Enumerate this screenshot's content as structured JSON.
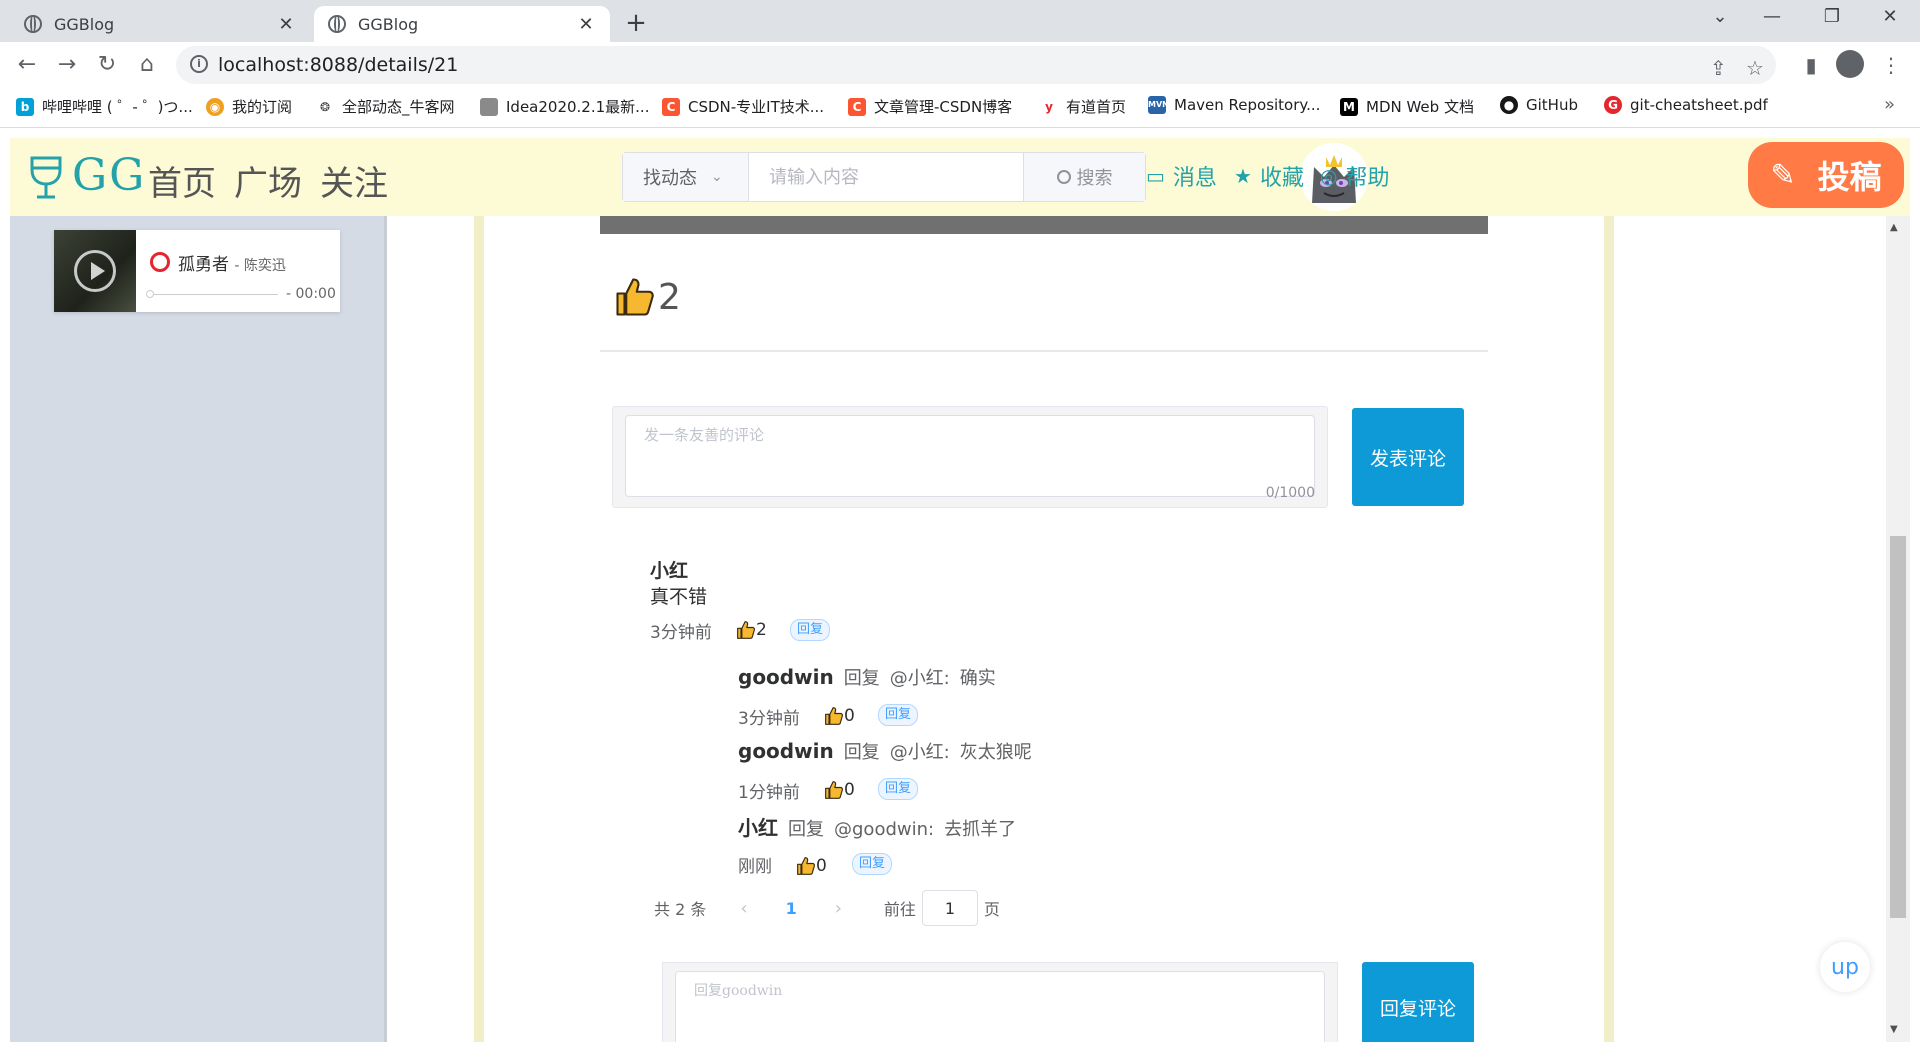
{
  "browser": {
    "tabs": [
      {
        "title": "GGBlog",
        "active": false
      },
      {
        "title": "GGBlog",
        "active": true
      }
    ],
    "url": "localhost:8088/details/21",
    "bookmarks": [
      {
        "label": "哔哩哔哩 ( ゜- ゜)つ...",
        "color": "#00a1d6",
        "icon": "bilibili-icon"
      },
      {
        "label": "我的订阅",
        "color": "#f0a020",
        "icon": "subscribe-icon"
      },
      {
        "label": "全部动态_牛客网",
        "color": "#3c4043",
        "icon": "nowcoder-icon"
      },
      {
        "label": "Idea2020.2.1最新...",
        "color": "#8a8a8a",
        "icon": "page-icon"
      },
      {
        "label": "CSDN-专业IT技术...",
        "color": "#fc5531",
        "icon": "csdn-icon"
      },
      {
        "label": "文章管理-CSDN博客",
        "color": "#fc5531",
        "icon": "csdn-icon"
      },
      {
        "label": "有道首页",
        "color": "#e5262f",
        "icon": "youdao-icon"
      },
      {
        "label": "Maven Repository...",
        "color": "#2a64a8",
        "icon": "maven-icon"
      },
      {
        "label": "MDN Web 文档",
        "color": "#000000",
        "icon": "mdn-icon"
      },
      {
        "label": "GitHub",
        "color": "#181717",
        "icon": "github-icon"
      },
      {
        "label": "git-cheatsheet.pdf",
        "color": "#e5262f",
        "icon": "pdf-icon"
      }
    ]
  },
  "header": {
    "logo_text": "GG",
    "nav": [
      "首页",
      "广场",
      "关注"
    ],
    "search": {
      "type_label": "找动态",
      "placeholder": "请输入内容",
      "button_label": "搜索"
    },
    "links": {
      "messages": "消息",
      "favorites": "收藏",
      "help": "帮助"
    },
    "post_label": "投稿",
    "accent_color": "#23a3a9",
    "post_color": "#ff7a45"
  },
  "music": {
    "song": "孤勇者",
    "artist": "- 陈奕迅",
    "time": "- 00:00"
  },
  "article": {
    "like_count": "2"
  },
  "comment_box": {
    "placeholder": "发一条友善的评论",
    "counter": "0/1000",
    "submit_label": "发表评论"
  },
  "comments": [
    {
      "user": "小红",
      "text": "真不错",
      "time": "3分钟前",
      "likes": "2",
      "reply_tag": "回复",
      "replies": [
        {
          "user": "goodwin",
          "verb": "回复",
          "target": "@小红:",
          "text": "确实",
          "time": "3分钟前",
          "likes": "0",
          "reply_tag": "回复"
        },
        {
          "user": "goodwin",
          "verb": "回复",
          "target": "@小红:",
          "text": "灰太狼呢",
          "time": "1分钟前",
          "likes": "0",
          "reply_tag": "回复"
        },
        {
          "user": "小红",
          "verb": "回复",
          "target": "@goodwin:",
          "text": "去抓羊了",
          "time": "刚刚",
          "likes": "0",
          "reply_tag": "回复"
        }
      ]
    }
  ],
  "pagination": {
    "total": "共 2 条",
    "current": "1",
    "goto_label": "前往",
    "goto_value": "1",
    "page_suffix": "页"
  },
  "reply_box": {
    "placeholder": "回复goodwin",
    "submit_label": "回复评论"
  },
  "up_label": "up",
  "primary_button_color": "#0e9ad6"
}
